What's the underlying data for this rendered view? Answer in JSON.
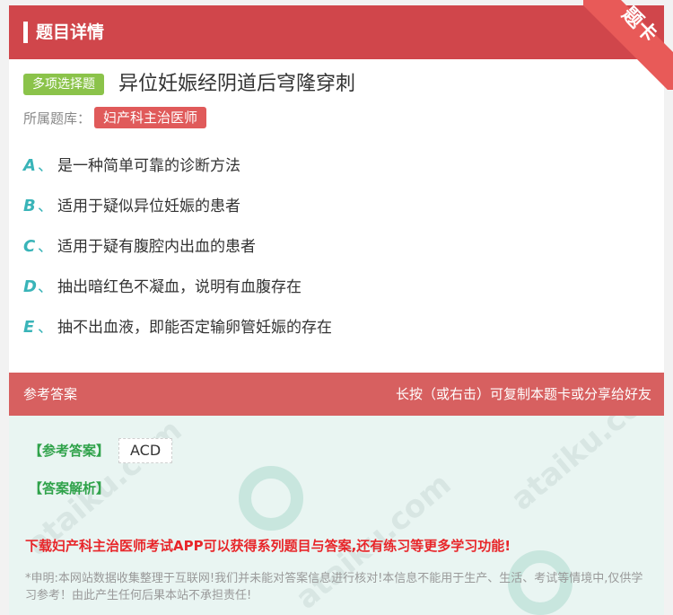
{
  "header": {
    "title": "题目详情",
    "corner_badge": "题卡"
  },
  "question": {
    "type_tag": "多项选择题",
    "title": "异位妊娠经阴道后穹隆穿刺",
    "bank_label": "所属题库：",
    "bank_name": "妇产科主治医师"
  },
  "options": [
    {
      "letter": "A",
      "sep": "、",
      "text": "是一种简单可靠的诊断方法"
    },
    {
      "letter": "B",
      "sep": "、",
      "text": "适用于疑似异位妊娠的患者"
    },
    {
      "letter": "C",
      "sep": "、",
      "text": "适用于疑有腹腔内出血的患者"
    },
    {
      "letter": "D",
      "sep": "、",
      "text": "抽出暗红色不凝血，说明有血腹存在"
    },
    {
      "letter": "E",
      "sep": "、",
      "text": "抽不出血液，即能否定输卵管妊娠的存在"
    }
  ],
  "answer_section": {
    "bar_left": "参考答案",
    "bar_right": "长按（或右击）可复制本题卡或分享给好友",
    "ref_label": "【参考答案】",
    "ref_value": "ACD",
    "analysis_label": "【答案解析】",
    "promo": "下载妇产科主治医师考试APP可以获得系列题目与答案,还有练习等更多学习功能!",
    "disclaimer": "*申明:本网站数据收集整理于互联网!我们并未能对答案信息进行核对!本信息不能用于生产、生活、考试等情境中,仅供学习参考！由此产生任何后果本站不承担责任!"
  },
  "colors": {
    "header": "#d0464b",
    "type_tag": "#8bc34a",
    "bank_tag": "#e05a5a",
    "option_letter": "#39b4b8",
    "answer_bar": "#d76060",
    "answer_bg": "#e9f5f2",
    "answer_label": "#2fa24a",
    "promo": "#e8262a"
  }
}
